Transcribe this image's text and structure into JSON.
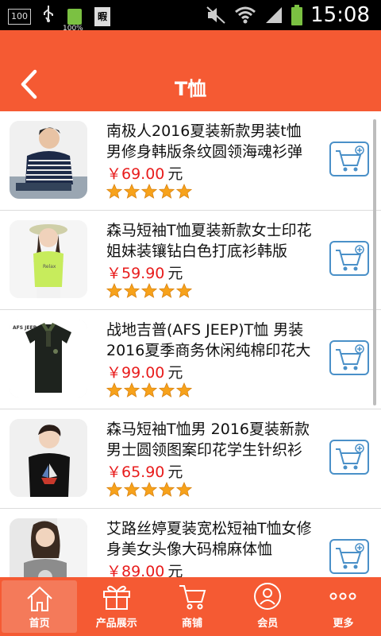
{
  "status_bar": {
    "box": "100",
    "battery_pct": "100%",
    "doc": "暇",
    "time": "15:08"
  },
  "header": {
    "title": "T恤"
  },
  "products": [
    {
      "name": "南极人2016夏装新款男装t恤男修身韩版条纹圆领海魂衫弹",
      "price": "￥69.00",
      "unit": "元",
      "rating": 5,
      "thumb": "navy-stripe-tee"
    },
    {
      "name": "森马短袖T恤夏装新款女士印花姐妹装镶钻白色打底衫韩版",
      "price": "￥59.90",
      "unit": "元",
      "rating": 5,
      "thumb": "lime-print-tee"
    },
    {
      "name": "战地吉普(AFS JEEP)T恤 男装2016夏季商务休闲纯棉印花大",
      "price": "￥99.00",
      "unit": "元",
      "rating": 5,
      "thumb": "black-polo",
      "thumb_text": "AFS JEEP"
    },
    {
      "name": "森马短袖T恤男 2016夏装新款男士圆领图案印花学生针织衫",
      "price": "￥65.90",
      "unit": "元",
      "rating": 5,
      "thumb": "black-boat-tee"
    },
    {
      "name": "艾路丝婷夏装宽松短袖T恤女修身美女头像大码棉麻体恤",
      "price": "￥89.00",
      "unit": "元",
      "rating": 5,
      "thumb": "gray-portrait-tee"
    }
  ],
  "tabs": [
    {
      "label": "首页",
      "icon": "home-icon",
      "active": true
    },
    {
      "label": "产品展示",
      "icon": "gift-icon",
      "active": false
    },
    {
      "label": "商铺",
      "icon": "cart-icon",
      "active": false
    },
    {
      "label": "会员",
      "icon": "user-icon",
      "active": false
    },
    {
      "label": "更多",
      "icon": "more-icon",
      "active": false
    }
  ],
  "colors": {
    "accent": "#f55a33",
    "price": "#e81c1c",
    "cart_border": "#4a90c8",
    "star": "#f7a21b"
  }
}
